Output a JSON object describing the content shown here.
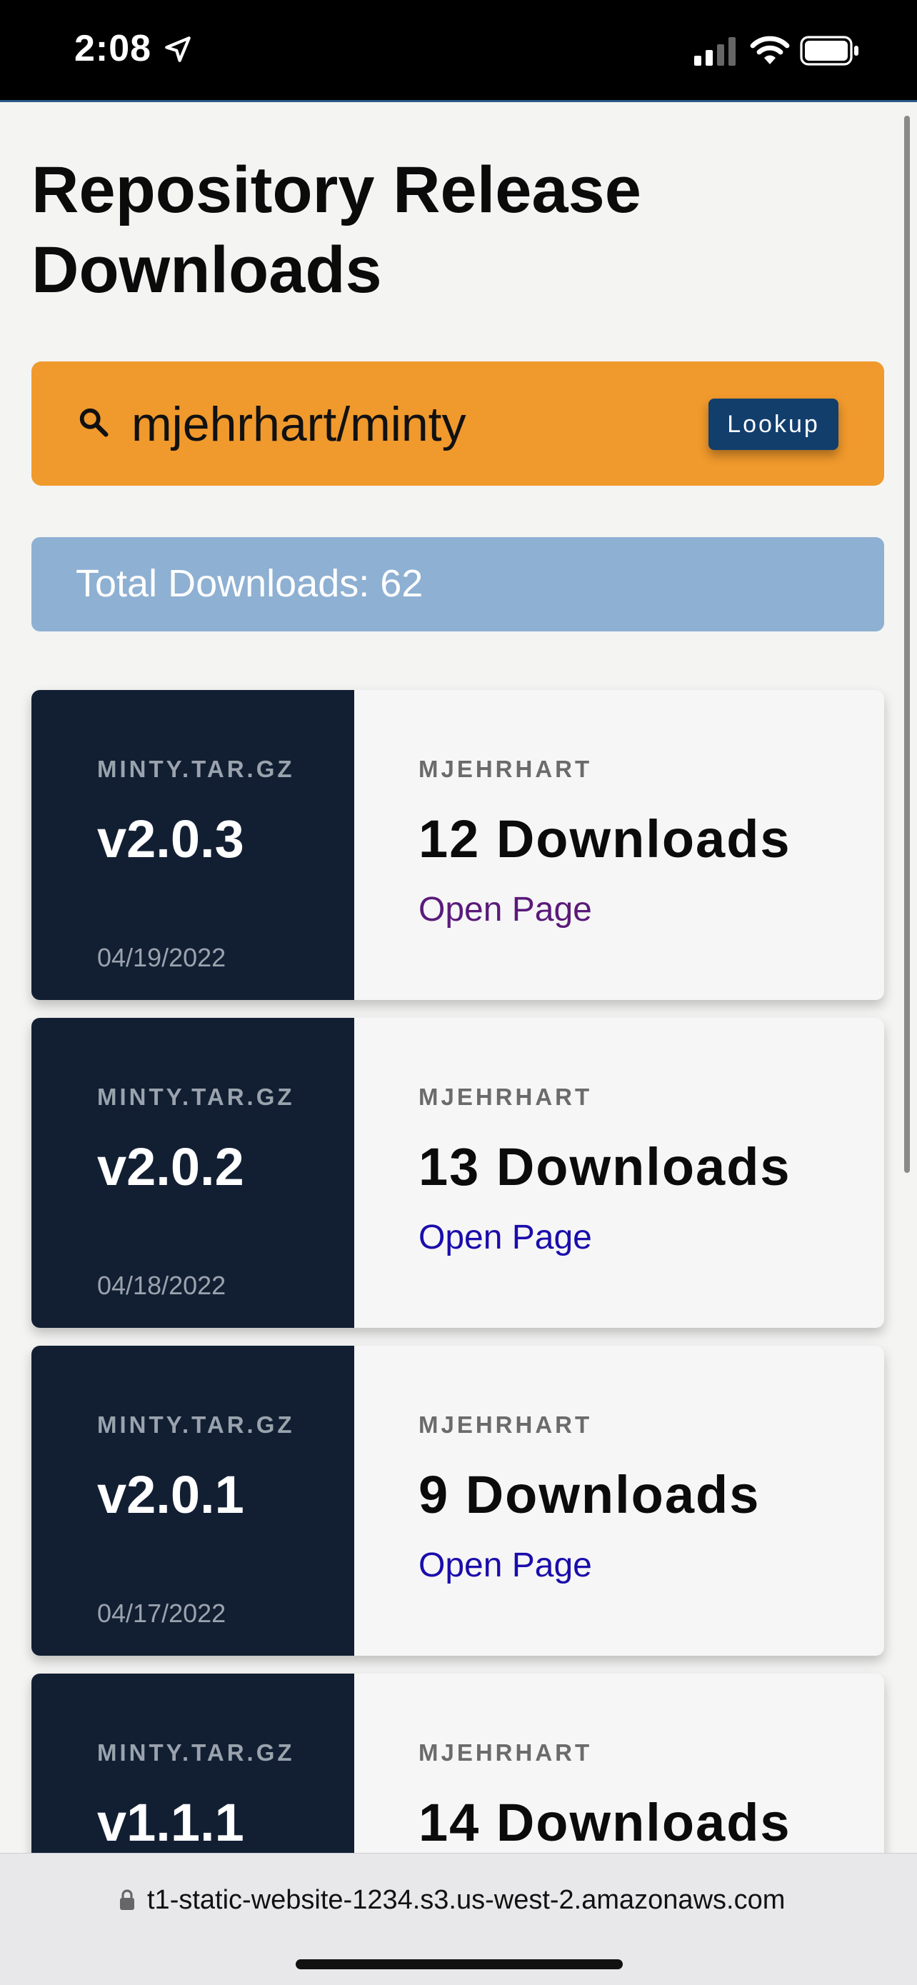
{
  "status_bar": {
    "time": "2:08",
    "icons": [
      "location-arrow-icon",
      "cellular-signal-icon",
      "wifi-icon",
      "battery-icon"
    ]
  },
  "page": {
    "title": "Repository Release Downloads"
  },
  "search": {
    "icon": "search-icon",
    "value": "mjehrhart/minty",
    "button_label": "Lookup"
  },
  "total": {
    "text": "Total Downloads: 62"
  },
  "releases": [
    {
      "file": "MINTY.TAR.GZ",
      "version": "v2.0.3",
      "date": "04/19/2022",
      "owner": "MJEHRHART",
      "downloads": "12 Downloads",
      "link": "Open Page",
      "visited": true
    },
    {
      "file": "MINTY.TAR.GZ",
      "version": "v2.0.2",
      "date": "04/18/2022",
      "owner": "MJEHRHART",
      "downloads": "13 Downloads",
      "link": "Open Page",
      "visited": false
    },
    {
      "file": "MINTY.TAR.GZ",
      "version": "v2.0.1",
      "date": "04/17/2022",
      "owner": "MJEHRHART",
      "downloads": "9 Downloads",
      "link": "Open Page",
      "visited": false
    },
    {
      "file": "MINTY.TAR.GZ",
      "version": "v1.1.1",
      "date": "",
      "owner": "MJEHRHART",
      "downloads": "14 Downloads",
      "link": "",
      "visited": false
    }
  ],
  "browser": {
    "url": "t1-static-website-1234.s3.us-west-2.amazonaws.com"
  },
  "colors": {
    "search_bg": "#f0992c",
    "lookup_button": "#123e6c",
    "total_bg": "#8eb0d2",
    "card_left": "#121f33",
    "link": "#1a0dab",
    "link_visited": "#5a1a7a"
  }
}
